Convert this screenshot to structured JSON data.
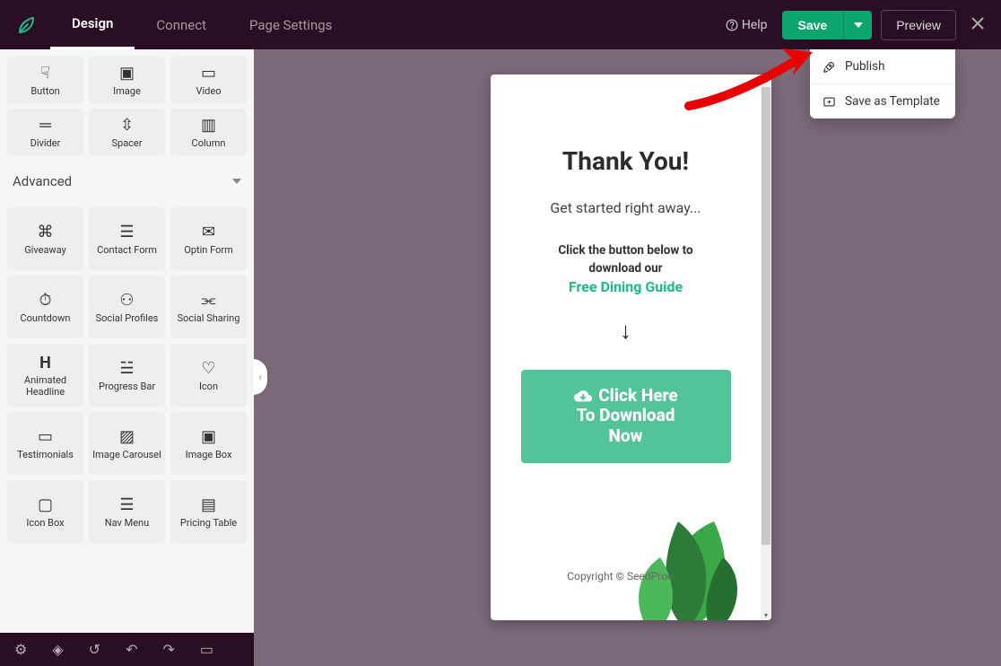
{
  "topbar": {
    "tabs": {
      "design": "Design",
      "connect": "Connect",
      "page_settings": "Page Settings"
    },
    "help": "Help",
    "save": "Save",
    "preview": "Preview"
  },
  "dropdown": {
    "publish": "Publish",
    "save_template": "Save as Template"
  },
  "sidebar": {
    "blocks1": {
      "button": "Button",
      "image": "Image",
      "video": "Video",
      "divider": "Divider",
      "spacer": "Spacer",
      "column": "Column"
    },
    "section_advanced": "Advanced",
    "blocks2": {
      "giveaway": "Giveaway",
      "contact_form": "Contact Form",
      "optin_form": "Optin Form",
      "countdown": "Countdown",
      "social_profiles": "Social Profiles",
      "social_sharing": "Social Sharing",
      "animated_headline": "Animated Headline",
      "progress_bar": "Progress Bar",
      "icon": "Icon",
      "testimonials": "Testimonials",
      "image_carousel": "Image Carousel",
      "image_box": "Image Box",
      "icon_box": "Icon Box",
      "nav_menu": "Nav Menu",
      "pricing_table": "Pricing Table"
    }
  },
  "preview": {
    "title": "Thank You!",
    "subtitle": "Get started right away...",
    "click_line1": "Click the button below to",
    "click_line2": "download our",
    "link": "Free Dining Guide",
    "arrow": "↓",
    "dl_line1": "Click Here",
    "dl_line2": "To Download",
    "dl_line3": "Now",
    "copyright": "Copyright © SeedProd"
  }
}
